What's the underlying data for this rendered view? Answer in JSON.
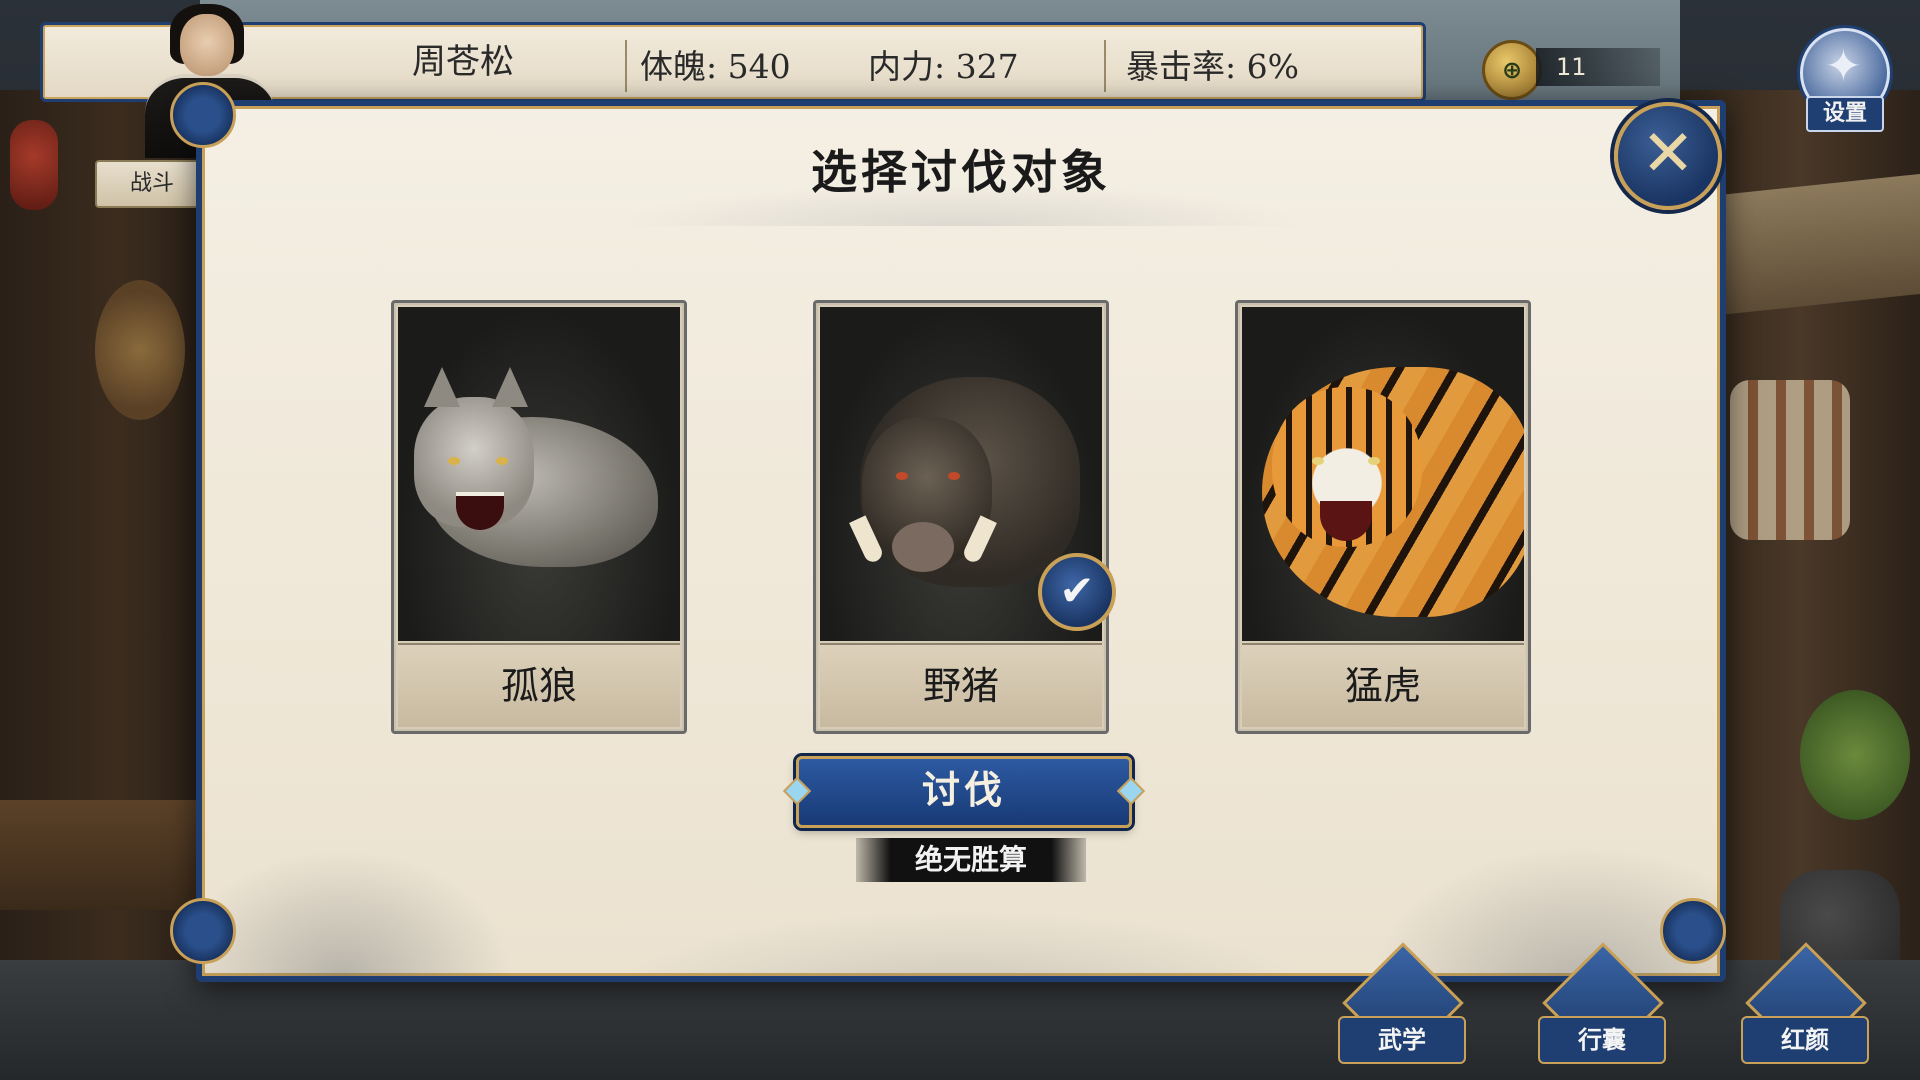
{
  "player": {
    "name": "周苍松",
    "stats": [
      {
        "label": "体魄: 540"
      },
      {
        "label": "内力: 327"
      },
      {
        "label": "暴击率: 6%"
      }
    ],
    "tab": "战斗"
  },
  "currency": {
    "icon": "jade-coin-icon",
    "amount": "11"
  },
  "settings": {
    "label": "设置",
    "icon": "gear-icon"
  },
  "modal": {
    "title": "选择讨伐对象",
    "close_icon": "close-icon",
    "targets": [
      {
        "name": "孤狼",
        "icon": "wolf-portrait",
        "selected": false
      },
      {
        "name": "野猪",
        "icon": "boar-portrait",
        "selected": true
      },
      {
        "name": "猛虎",
        "icon": "tiger-portrait",
        "selected": false
      }
    ],
    "action_label": "讨伐",
    "odds_text": "绝无胜算"
  },
  "bottom_nav": [
    {
      "label": "武学"
    },
    {
      "label": "行囊"
    },
    {
      "label": "红颜"
    }
  ],
  "colors": {
    "accent_blue": "#1f3f72",
    "gold_trim": "#c8a057",
    "parchment": "#f2ebdc"
  }
}
